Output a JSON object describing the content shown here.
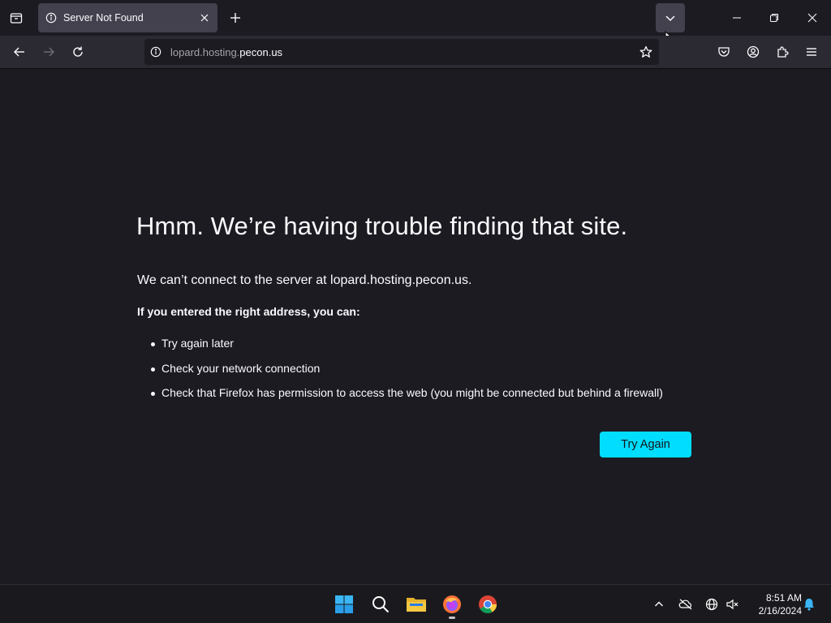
{
  "tab": {
    "title": "Server Not Found"
  },
  "urlbar": {
    "url_prefix": "lopard.hosting.",
    "url_domain": "pecon.us"
  },
  "error_page": {
    "title": "Hmm. We’re having trouble finding that site.",
    "description": "We can’t connect to the server at lopard.hosting.pecon.us.",
    "lead": "If you entered the right address, you can:",
    "suggestions": [
      "Try again later",
      "Check your network connection",
      "Check that Firefox has permission to access the web (you might be connected but behind a firewall)"
    ],
    "try_again_label": "Try Again"
  },
  "taskbar": {
    "time": "8:51 AM",
    "date": "2/16/2024",
    "pinned_apps": [
      "start-icon",
      "search-icon",
      "file-explorer-icon",
      "firefox-icon",
      "chrome-icon"
    ]
  },
  "colors": {
    "accent": "#00ddff",
    "page_bg": "#1c1b22",
    "toolbar_bg": "#2b2a33",
    "tab_bg": "#42414d"
  }
}
